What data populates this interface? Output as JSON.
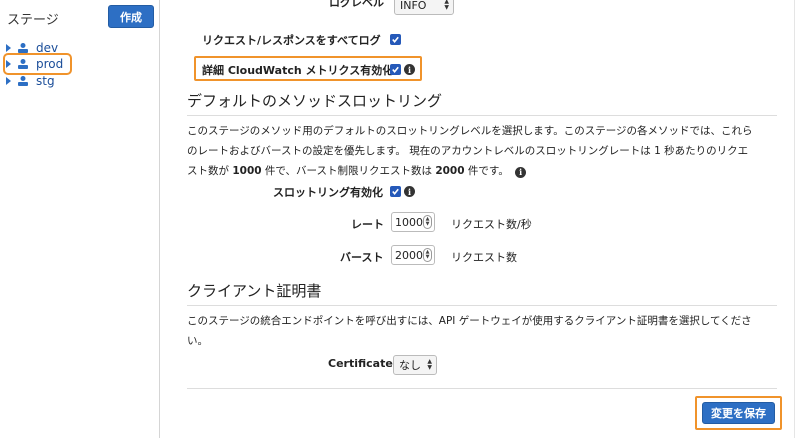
{
  "sidebar": {
    "title": "ステージ",
    "create_label": "作成",
    "stages": [
      {
        "label": "dev"
      },
      {
        "label": "prod"
      },
      {
        "label": "stg"
      }
    ]
  },
  "logging": {
    "loglevel_label": "ログレベル",
    "loglevel_value": "INFO",
    "log_all_label": "リクエスト/レスポンスをすべてログ",
    "detailed_metrics_label": "詳細 CloudWatch メトリクス有効化"
  },
  "throttling": {
    "heading": "デフォルトのメソッドスロットリング",
    "desc_line1": "このステージのメソッド用のデフォルトのスロットリングレベルを選択します。このステージの各メソッドでは、これら",
    "desc_line2": "のレートおよびバーストの設定を優先します。 現在のアカウントレベルのスロットリングレートは 1 秒あたりのリクエ",
    "desc_line3_a": "スト数が ",
    "desc_rate": "1000",
    "desc_line3_b": " 件で、バースト制限リクエスト数は ",
    "desc_burst": "2000",
    "desc_line3_c": " 件です。",
    "enable_label": "スロットリング有効化",
    "rate_label": "レート",
    "rate_value": "1000",
    "rate_unit": "リクエスト数/秒",
    "burst_label": "バースト",
    "burst_value": "2000",
    "burst_unit": "リクエスト数"
  },
  "client_cert": {
    "heading": "クライアント証明書",
    "desc_line1": "このステージの統合エンドポイントを呼び出すには、API ゲートウェイが使用するクライアント証明書を選択してくださ",
    "desc_line2": "い。",
    "certificate_label": "Certificate",
    "certificate_value": "なし"
  },
  "save_label": "変更を保存",
  "colors": {
    "accent": "#2d6fc4",
    "highlight": "#f0932b",
    "link": "#1a4d99"
  }
}
